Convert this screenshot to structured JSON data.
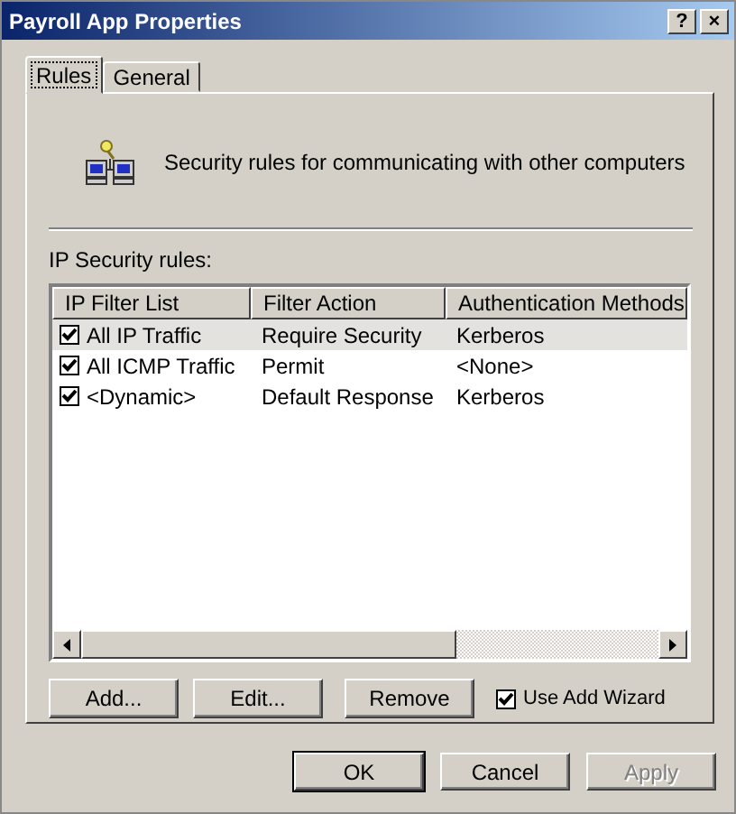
{
  "window": {
    "title": "Payroll App Properties",
    "title_buttons": [
      "?",
      "×"
    ]
  },
  "tabs": [
    {
      "label": "Rules",
      "selected": true
    },
    {
      "label": "General",
      "selected": false
    }
  ],
  "header": {
    "text": "Security rules for communicating with other computers"
  },
  "list_label": "IP Security rules:",
  "table": {
    "columns": [
      "IP Filter List",
      "Filter Action",
      "Authentication Methods"
    ],
    "rows": [
      {
        "cells": [
          "All IP Traffic",
          "Require Security",
          "Kerberos"
        ],
        "checked": true,
        "selected": true
      },
      {
        "cells": [
          "All ICMP Traffic",
          "Permit",
          "<None>"
        ],
        "checked": true,
        "selected": false
      },
      {
        "cells": [
          "<Dynamic>",
          "Default Response",
          "Kerberos"
        ],
        "checked": true,
        "selected": false
      }
    ]
  },
  "actions": [
    {
      "label": "Add...",
      "disabled": false
    },
    {
      "label": "Edit...",
      "disabled": false
    },
    {
      "label": "Remove",
      "disabled": false
    }
  ],
  "wizard": {
    "label": "Use Add Wizard",
    "checked": true
  },
  "buttons": [
    {
      "label": "OK",
      "disabled": false,
      "default": true
    },
    {
      "label": "Cancel",
      "disabled": false,
      "default": false
    },
    {
      "label": "Apply",
      "disabled": true,
      "default": false
    }
  ]
}
